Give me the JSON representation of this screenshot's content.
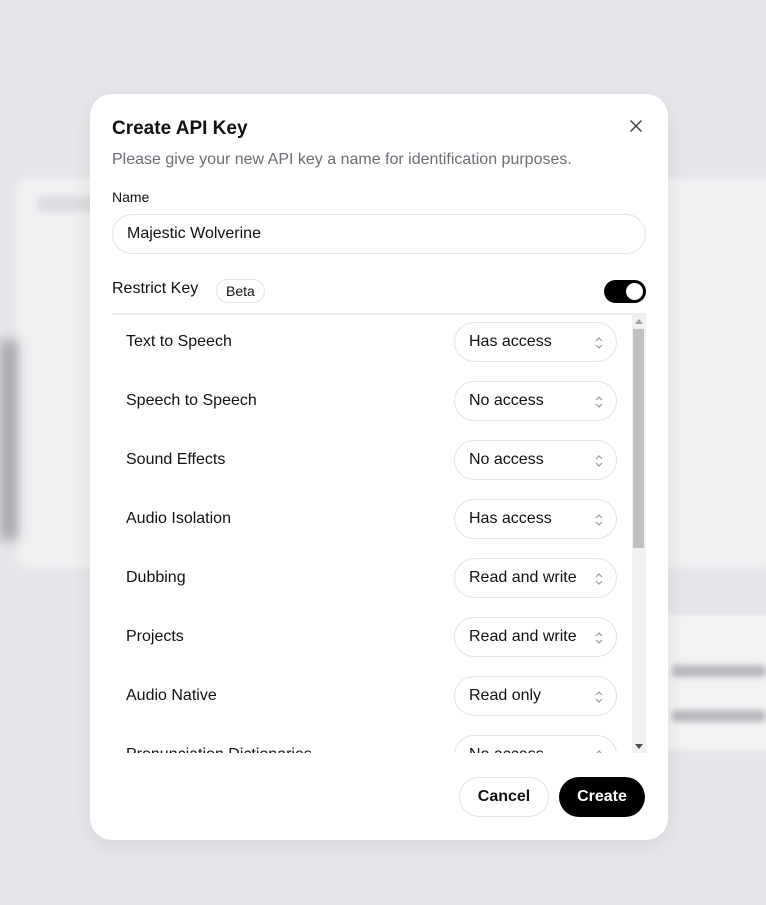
{
  "modal": {
    "title": "Create API Key",
    "subtitle": "Please give your new API key a name for identification purposes.",
    "name_label": "Name",
    "name_value": "Majestic Wolverine",
    "restrict_label": "Restrict Key",
    "beta_badge": "Beta",
    "restrict_enabled": true,
    "permissions": [
      {
        "name": "Text to Speech",
        "access": "Has access"
      },
      {
        "name": "Speech to Speech",
        "access": "No access"
      },
      {
        "name": "Sound Effects",
        "access": "No access"
      },
      {
        "name": "Audio Isolation",
        "access": "Has access"
      },
      {
        "name": "Dubbing",
        "access": "Read and write"
      },
      {
        "name": "Projects",
        "access": "Read and write"
      },
      {
        "name": "Audio Native",
        "access": "Read only"
      },
      {
        "name": "Pronunciation Dictionaries",
        "access": "No access"
      }
    ],
    "cancel_label": "Cancel",
    "create_label": "Create"
  },
  "colors": {
    "primary": "#000000",
    "muted_text": "#6b6e76",
    "border": "#e4e4e7"
  },
  "icons": {
    "close": "close-icon",
    "select": "chevron-up-down-icon"
  }
}
